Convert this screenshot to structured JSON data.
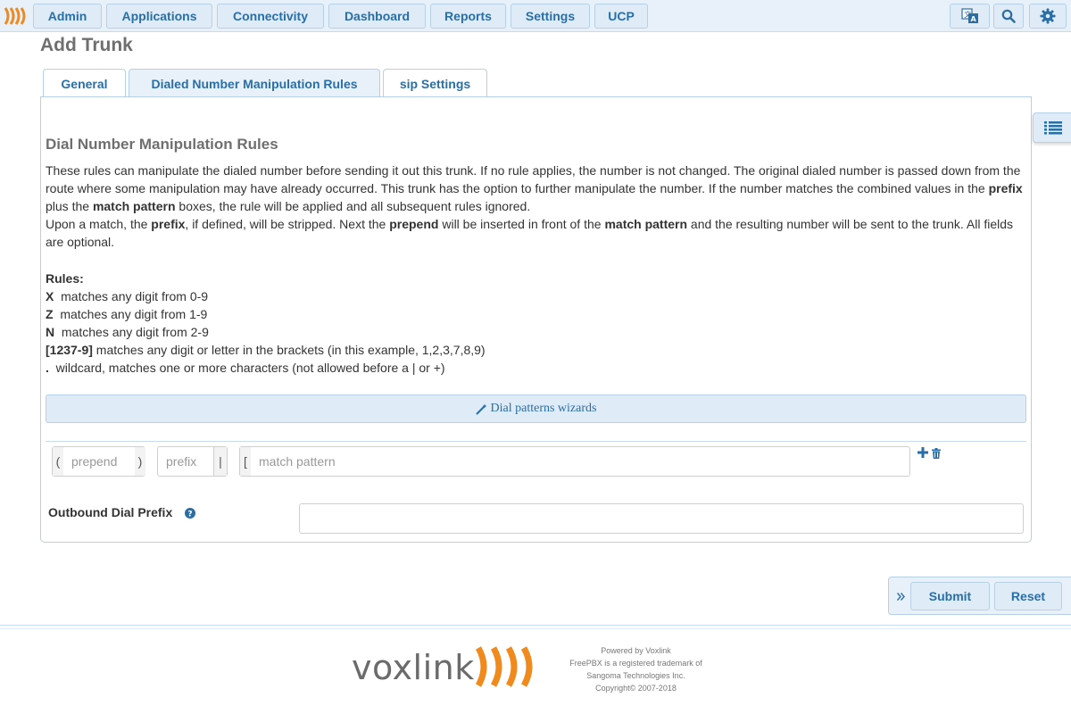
{
  "navbar": {
    "logo_icon": "voxlink-logo-icon",
    "items": [
      {
        "label": "Admin"
      },
      {
        "label": "Applications"
      },
      {
        "label": "Connectivity"
      },
      {
        "label": "Dashboard"
      },
      {
        "label": "Reports"
      },
      {
        "label": "Settings"
      },
      {
        "label": "UCP"
      }
    ],
    "icons": [
      "language-icon",
      "search-icon",
      "gear-icon"
    ]
  },
  "page": {
    "title": "Add Trunk"
  },
  "tabs": [
    {
      "label": "General",
      "active": false
    },
    {
      "label": "Dialed Number Manipulation Rules",
      "active": true
    },
    {
      "label": "sip Settings",
      "active": false
    }
  ],
  "section": {
    "heading": "Dial Number Manipulation Rules",
    "para1": {
      "t1": "These rules can manipulate the dialed number before sending it out this trunk. If no rule applies, the number is not changed. The original dialed number is passed down from the route where some manipulation may have already occurred. This trunk has the option to further manipulate the number. If the number matches the combined values in the ",
      "b1": "prefix",
      "t2": " plus the ",
      "b2": "match pattern",
      "t3": " boxes, the rule will be applied and all subsequent rules ignored."
    },
    "para2": {
      "t1": "Upon a match, the ",
      "b1": "prefix",
      "t2": ", if defined, will be stripped. Next the ",
      "b2": "prepend",
      "t3": " will be inserted in front of the ",
      "b3": "match pattern",
      "t4": " and the resulting number will be sent to the trunk. All fields are optional."
    },
    "rules_heading": "Rules:",
    "rules": [
      {
        "key": "X",
        "text": "  matches any digit from 0-9"
      },
      {
        "key": "Z",
        "text": "  matches any digit from 1-9"
      },
      {
        "key": "N",
        "text": "  matches any digit from 2-9"
      },
      {
        "key": "[1237-9]",
        "text": " matches any digit or letter in the brackets (in this example, 1,2,3,7,8,9)"
      },
      {
        "key": ".",
        "text": "  wildcard, matches one or more characters (not allowed before a | or +)"
      }
    ]
  },
  "wizard": {
    "label": "Dial patterns wizards",
    "icon": "magic-wand-icon"
  },
  "pattern_row": {
    "open_paren": "(",
    "close_paren": ")",
    "pipe": "|",
    "open_bracket": "[",
    "prepend_placeholder": "prepend",
    "prefix_placeholder": "prefix",
    "match_placeholder": "match pattern",
    "add_icon": "plus-icon",
    "delete_icon": "trash-icon"
  },
  "outbound": {
    "label": "Outbound Dial Prefix",
    "help_icon": "help-circle-icon",
    "value": ""
  },
  "side_toggle_icon": "list-icon",
  "actions": {
    "expand_icon": "double-chevron-right-icon",
    "submit": "Submit",
    "reset": "Reset"
  },
  "footer": {
    "brand": "voxlink",
    "line1": "Powered by Voxlink",
    "line2": "FreePBX is a registered trademark of",
    "line3": "Sangoma Technologies Inc.",
    "line4": "Copyright© 2007-2018"
  },
  "colors": {
    "accent": "#2a6ea6",
    "brand_orange": "#f08a1c",
    "nav_bg": "#e8f1f9",
    "border": "#b6d0e6"
  }
}
